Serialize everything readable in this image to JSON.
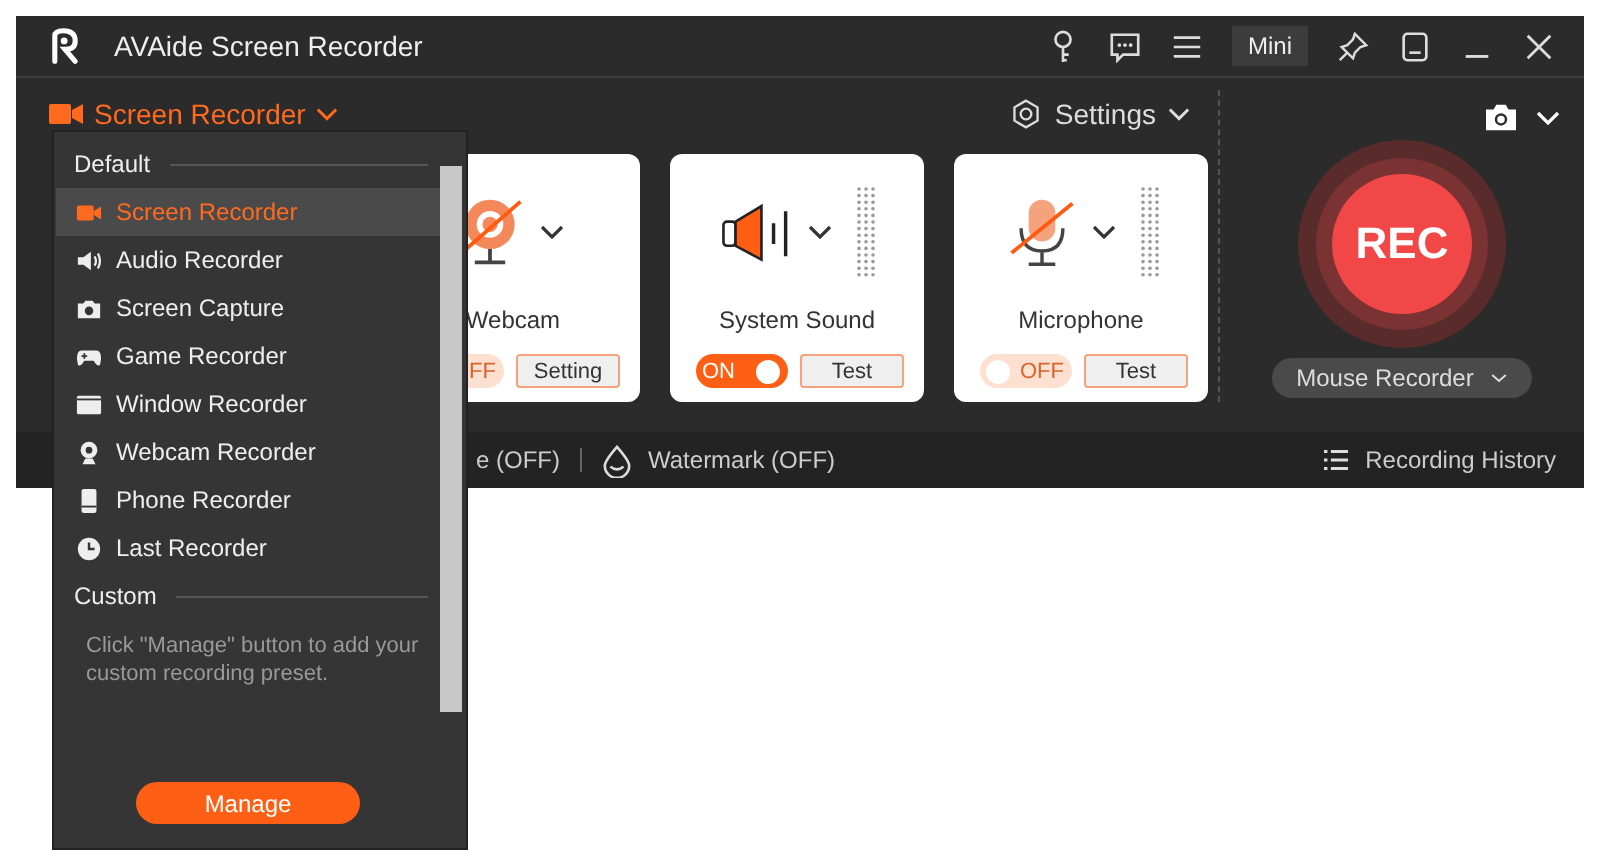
{
  "window": {
    "title": "AVAide Screen Recorder",
    "mini_button": "Mini"
  },
  "toolbar": {
    "mode": "Screen Recorder",
    "settings": "Settings"
  },
  "sources": [
    {
      "kind": "webcam",
      "label": "Webcam",
      "toggle": {
        "on": false,
        "label": "FF"
      },
      "button": "Setting",
      "meter": false
    },
    {
      "kind": "speaker",
      "label": "System Sound",
      "toggle": {
        "on": true,
        "label": "ON"
      },
      "button": "Test",
      "meter": true
    },
    {
      "kind": "microphone",
      "label": "Microphone",
      "toggle": {
        "on": false,
        "label": "OFF"
      },
      "button": "Test",
      "meter": true
    }
  ],
  "record": {
    "button": "REC",
    "mode": "Mouse Recorder"
  },
  "status_bar": {
    "items": [
      {
        "kind": "plain",
        "label": "e (OFF)"
      },
      {
        "kind": "watermark",
        "label": "Watermark (OFF)"
      }
    ],
    "history": "Recording History"
  },
  "menu": {
    "sections": [
      {
        "title": "Default",
        "items": [
          {
            "kind": "video",
            "label": "Screen Recorder",
            "selected": true
          },
          {
            "kind": "speaker",
            "label": "Audio Recorder",
            "selected": false
          },
          {
            "kind": "camera",
            "label": "Screen Capture",
            "selected": false
          },
          {
            "kind": "gamepad",
            "label": "Game Recorder",
            "selected": false
          },
          {
            "kind": "window",
            "label": "Window Recorder",
            "selected": false
          },
          {
            "kind": "webcam",
            "label": "Webcam Recorder",
            "selected": false
          },
          {
            "kind": "phone",
            "label": "Phone Recorder",
            "selected": false
          },
          {
            "kind": "clock",
            "label": "Last Recorder",
            "selected": false
          }
        ]
      },
      {
        "title": "Custom",
        "hint": "Click \"Manage\" button to add your custom recording preset."
      }
    ],
    "button": "Manage"
  }
}
